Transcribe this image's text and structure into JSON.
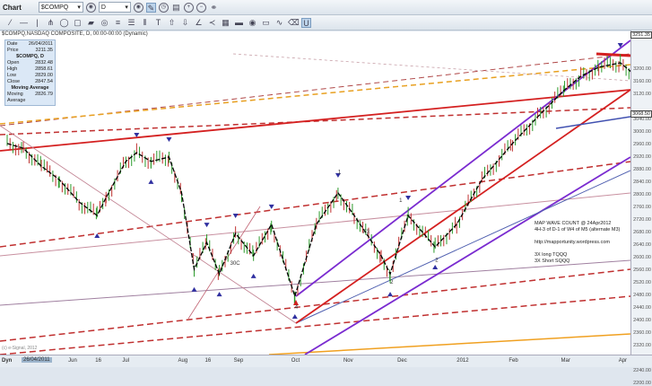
{
  "toolbar": {
    "title": "Chart",
    "symbol": "$COMPQ",
    "interval": "D"
  },
  "header": "$COMPQ,NASDAQ COMPOSITE, D, 00:00-00:00 (Dynamic)",
  "data_window": {
    "date_label": "Date",
    "date": "26/04/2011",
    "price_label": "Price",
    "price": "3211.35",
    "series_title": "$COMPQ, D",
    "open_label": "Open",
    "open": "2832.48",
    "high_label": "High",
    "high": "2858.61",
    "low_label": "Low",
    "low": "2829.00",
    "close_label": "Close",
    "close": "2847.54",
    "ma_title": "Moving Average",
    "ma_label": "Moving Average",
    "ma": "2826.79"
  },
  "annotation": {
    "line1": "MAP WAVE COUNT @ 24Apr2012",
    "line2": "4H-3 of D-1 of W4 of M5 (alternate M3)",
    "line3": "http://mapportunity.wordpress.com",
    "line4": "3X long TQQQ",
    "line5": "3X Short SQQQ"
  },
  "watermark": "(c) e-Signal, 2012",
  "footer": {
    "dyn": "Dyn",
    "date_box": "26/04/2011"
  },
  "colors": {
    "up_bar": "#2a9a2a",
    "down_bar": "#c03030",
    "price_line": "#000000",
    "red_channel": "#d42020",
    "purple_channel": "#7a2bd0",
    "orange": "#f0a020"
  },
  "chart_data": {
    "type": "line",
    "xlabel": "",
    "ylabel": "",
    "ylim": [
      2200,
      3240
    ],
    "yticks": [
      "3200.00",
      "3160.00",
      "3120.00",
      "3040.00",
      "3000.00",
      "2960.00",
      "2920.00",
      "2880.00",
      "2840.00",
      "2800.00",
      "2760.00",
      "2720.00",
      "2680.00",
      "2640.00",
      "2600.00",
      "2560.00",
      "2520.00",
      "2480.00",
      "2440.00",
      "2400.00",
      "2360.00",
      "2320.00",
      "2280.00",
      "2240.00",
      "2200.00"
    ],
    "top_label": "3251.35",
    "last_price": "3068.50",
    "xticks": [
      {
        "label": "Jun",
        "date": "2011-06-01"
      },
      {
        "label": "16",
        "date": "2011-06-16"
      },
      {
        "label": "Jul",
        "date": "2011-07-01"
      },
      {
        "label": "Aug",
        "date": "2011-08-01"
      },
      {
        "label": "16",
        "date": "2011-08-16"
      },
      {
        "label": "Sep",
        "date": "2011-09-01"
      },
      {
        "label": "Oct",
        "date": "2011-10-03"
      },
      {
        "label": "Nov",
        "date": "2011-11-01"
      },
      {
        "label": "Dec",
        "date": "2011-12-01"
      },
      {
        "label": "2012",
        "date": "2012-01-03"
      },
      {
        "label": "Feb",
        "date": "2012-02-01"
      },
      {
        "label": "Mar",
        "date": "2012-03-01"
      },
      {
        "label": "Apr",
        "date": "2012-04-02"
      }
    ],
    "series": [
      {
        "values": [
          [
            "2011-04-26",
            2866
          ],
          [
            "2011-05-05",
            2851
          ],
          [
            "2011-05-15",
            2794
          ],
          [
            "2011-05-25",
            2751
          ],
          [
            "2011-06-05",
            2680
          ],
          [
            "2011-06-15",
            2637
          ],
          [
            "2011-06-20",
            2694
          ],
          [
            "2011-07-01",
            2809
          ],
          [
            "2011-07-07",
            2837
          ],
          [
            "2011-07-15",
            2809
          ],
          [
            "2011-07-25",
            2823
          ],
          [
            "2011-08-01",
            2709
          ],
          [
            "2011-08-08",
            2466
          ],
          [
            "2011-08-15",
            2551
          ],
          [
            "2011-08-22",
            2451
          ],
          [
            "2011-08-31",
            2580
          ],
          [
            "2011-09-10",
            2509
          ],
          [
            "2011-09-20",
            2609
          ],
          [
            "2011-10-03",
            2380
          ],
          [
            "2011-10-15",
            2609
          ],
          [
            "2011-10-27",
            2709
          ],
          [
            "2011-11-05",
            2637
          ],
          [
            "2011-11-20",
            2509
          ],
          [
            "2011-11-25",
            2451
          ],
          [
            "2011-12-05",
            2637
          ],
          [
            "2011-12-20",
            2537
          ],
          [
            "2012-01-01",
            2609
          ],
          [
            "2012-01-15",
            2751
          ],
          [
            "2012-02-01",
            2866
          ],
          [
            "2012-02-15",
            2951
          ],
          [
            "2012-03-01",
            3037
          ],
          [
            "2012-03-10",
            3080
          ],
          [
            "2012-03-20",
            3109
          ],
          [
            "2012-04-01",
            3123
          ],
          [
            "2012-04-10",
            3080
          ]
        ]
      }
    ],
    "wave_labels": [
      {
        "text": "30C",
        "date": "2011-08-28",
        "value": 2480
      },
      {
        "text": "F3",
        "date": "2011-11-10",
        "value": 2580
      },
      {
        "text": "4",
        "date": "2011-10-03",
        "value": 2340
      },
      {
        "text": "2",
        "date": "2011-11-25",
        "value": 2420
      },
      {
        "text": "2",
        "date": "2011-12-20",
        "value": 2490
      },
      {
        "text": "1",
        "date": "2011-10-27",
        "value": 2770
      },
      {
        "text": "1",
        "date": "2011-11-30",
        "value": 2680
      }
    ]
  }
}
